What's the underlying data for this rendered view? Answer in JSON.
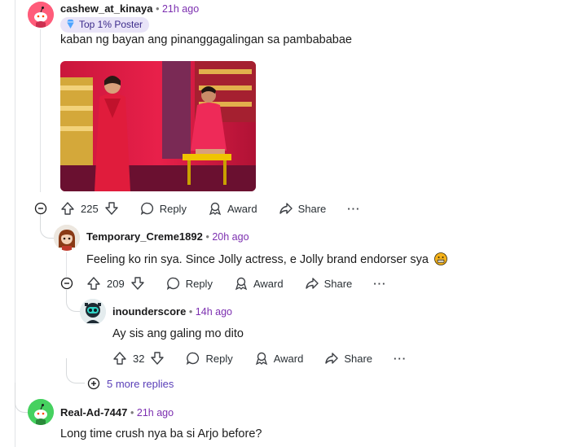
{
  "comments": [
    {
      "user": "cashew_at_kinaya",
      "time": "21h ago",
      "flair": "Top 1% Poster",
      "text": "kaban ng bayan ang pinanggagalingan sa pambababae",
      "votes": "225",
      "reply": "Reply",
      "award": "Award",
      "share": "Share",
      "more": "···"
    },
    {
      "user": "Temporary_Creme1892",
      "time": "20h ago",
      "text": "Feeling ko rin sya. Since Jolly actress, e Jolly brand endorser sya",
      "votes": "209",
      "reply": "Reply",
      "award": "Award",
      "share": "Share",
      "more": "···"
    },
    {
      "user": "inounderscore",
      "time": "14h ago",
      "text": "Ay sis ang galing mo dito",
      "votes": "32",
      "reply": "Reply",
      "award": "Award",
      "share": "Share",
      "more": "···"
    },
    {
      "user": "Real-Ad-7447",
      "time": "21h ago",
      "text": "Long time crush nya ba si Arjo before?"
    }
  ],
  "more_replies": "5 more replies",
  "colors": {
    "meta": "#7c2fb0",
    "avatar1": "#ff4f6f",
    "avatar4": "#46d160"
  }
}
